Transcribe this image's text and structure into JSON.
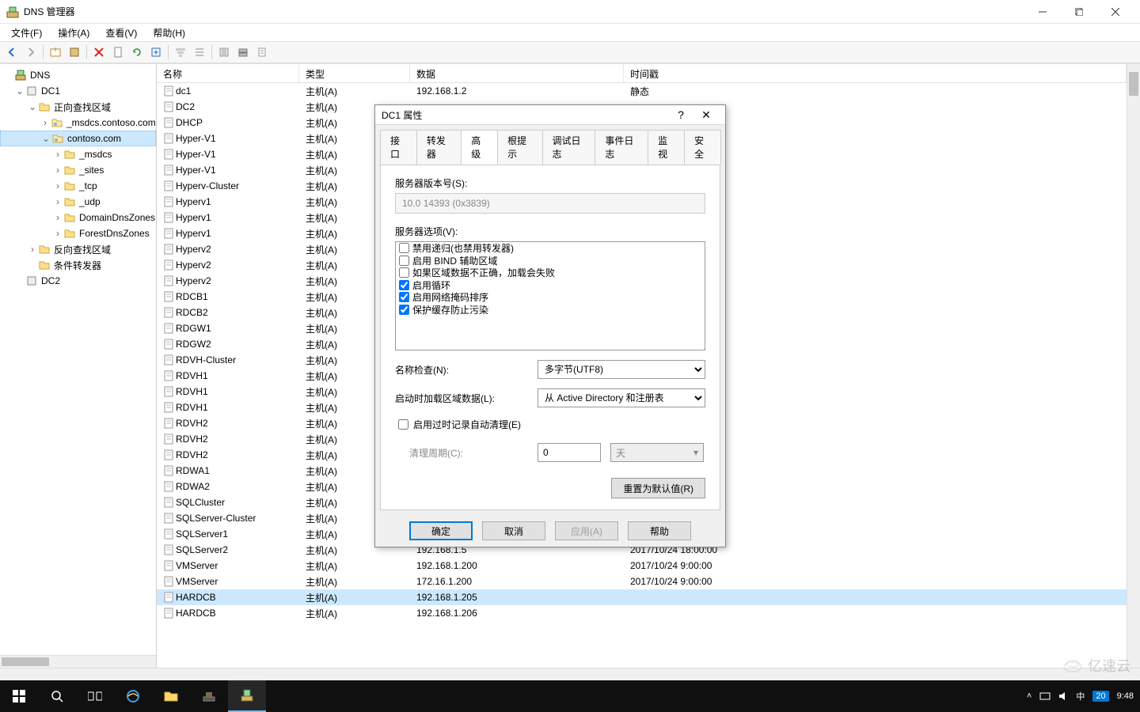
{
  "window": {
    "title": "DNS 管理器"
  },
  "menu": {
    "file": "文件(F)",
    "action": "操作(A)",
    "view": "查看(V)",
    "help": "帮助(H)"
  },
  "tree": {
    "root": "DNS",
    "dc1": "DC1",
    "fwd": "正向查找区域",
    "msdcs_contoso": "_msdcs.contoso.com",
    "contoso": "contoso.com",
    "msdcs": "_msdcs",
    "sites": "_sites",
    "tcp": "_tcp",
    "udp": "_udp",
    "domaindns": "DomainDnsZones",
    "forestdns": "ForestDnsZones",
    "rev": "反向查找区域",
    "cond": "条件转发器",
    "dc2": "DC2"
  },
  "columns": {
    "name": "名称",
    "type": "类型",
    "data": "数据",
    "ts": "时间戳"
  },
  "records": [
    {
      "name": "dc1",
      "type": "主机(A)",
      "data": "192.168.1.2",
      "ts": "静态"
    },
    {
      "name": "DC2",
      "type": "主机(A)",
      "data": "",
      "ts": ""
    },
    {
      "name": "DHCP",
      "type": "主机(A)",
      "data": "",
      "ts": ""
    },
    {
      "name": "Hyper-V1",
      "type": "主机(A)",
      "data": "",
      "ts": ""
    },
    {
      "name": "Hyper-V1",
      "type": "主机(A)",
      "data": "",
      "ts": ""
    },
    {
      "name": "Hyper-V1",
      "type": "主机(A)",
      "data": "",
      "ts": ""
    },
    {
      "name": "Hyperv-Cluster",
      "type": "主机(A)",
      "data": "",
      "ts": ""
    },
    {
      "name": "Hyperv1",
      "type": "主机(A)",
      "data": "",
      "ts": ""
    },
    {
      "name": "Hyperv1",
      "type": "主机(A)",
      "data": "",
      "ts": ""
    },
    {
      "name": "Hyperv1",
      "type": "主机(A)",
      "data": "",
      "ts": ""
    },
    {
      "name": "Hyperv2",
      "type": "主机(A)",
      "data": "",
      "ts": ""
    },
    {
      "name": "Hyperv2",
      "type": "主机(A)",
      "data": "",
      "ts": ""
    },
    {
      "name": "Hyperv2",
      "type": "主机(A)",
      "data": "",
      "ts": ""
    },
    {
      "name": "RDCB1",
      "type": "主机(A)",
      "data": "",
      "ts": ""
    },
    {
      "name": "RDCB2",
      "type": "主机(A)",
      "data": "",
      "ts": ""
    },
    {
      "name": "RDGW1",
      "type": "主机(A)",
      "data": "",
      "ts": ""
    },
    {
      "name": "RDGW2",
      "type": "主机(A)",
      "data": "",
      "ts": ""
    },
    {
      "name": "RDVH-Cluster",
      "type": "主机(A)",
      "data": "",
      "ts": ""
    },
    {
      "name": "RDVH1",
      "type": "主机(A)",
      "data": "",
      "ts": ""
    },
    {
      "name": "RDVH1",
      "type": "主机(A)",
      "data": "",
      "ts": ""
    },
    {
      "name": "RDVH1",
      "type": "主机(A)",
      "data": "",
      "ts": ""
    },
    {
      "name": "RDVH2",
      "type": "主机(A)",
      "data": "",
      "ts": ""
    },
    {
      "name": "RDVH2",
      "type": "主机(A)",
      "data": "",
      "ts": ""
    },
    {
      "name": "RDVH2",
      "type": "主机(A)",
      "data": "",
      "ts": ""
    },
    {
      "name": "RDWA1",
      "type": "主机(A)",
      "data": "",
      "ts": ""
    },
    {
      "name": "RDWA2",
      "type": "主机(A)",
      "data": "",
      "ts": ""
    },
    {
      "name": "SQLCluster",
      "type": "主机(A)",
      "data": "",
      "ts": ""
    },
    {
      "name": "SQLServer-Cluster",
      "type": "主机(A)",
      "data": "",
      "ts": ""
    },
    {
      "name": "SQLServer1",
      "type": "主机(A)",
      "data": "",
      "ts": ""
    },
    {
      "name": "SQLServer2",
      "type": "主机(A)",
      "data": "192.168.1.5",
      "ts": "2017/10/24 18:00:00"
    },
    {
      "name": "VMServer",
      "type": "主机(A)",
      "data": "192.168.1.200",
      "ts": "2017/10/24 9:00:00"
    },
    {
      "name": "VMServer",
      "type": "主机(A)",
      "data": "172.16.1.200",
      "ts": "2017/10/24 9:00:00"
    },
    {
      "name": "HARDCB",
      "type": "主机(A)",
      "data": "192.168.1.205",
      "ts": "",
      "sel": true
    },
    {
      "name": "HARDCB",
      "type": "主机(A)",
      "data": "192.168.1.206",
      "ts": ""
    }
  ],
  "dialog": {
    "title": "DC1 属性",
    "tabs": {
      "iface": "接口",
      "fwd": "转发器",
      "adv": "高级",
      "root": "根提示",
      "debug": "调试日志",
      "event": "事件日志",
      "mon": "监视",
      "sec": "安全"
    },
    "version_label": "服务器版本号(S):",
    "version_value": "10.0 14393 (0x3839)",
    "options_label": "服务器选项(V):",
    "options": [
      {
        "label": "禁用递归(也禁用转发器)",
        "checked": false
      },
      {
        "label": "启用 BIND 辅助区域",
        "checked": false
      },
      {
        "label": "如果区域数据不正确，加载会失败",
        "checked": false
      },
      {
        "label": "启用循环",
        "checked": true
      },
      {
        "label": "启用网络掩码排序",
        "checked": true
      },
      {
        "label": "保护缓存防止污染",
        "checked": true
      }
    ],
    "namecheck_label": "名称检查(N):",
    "namecheck_value": "多字节(UTF8)",
    "loadzone_label": "启动时加载区域数据(L):",
    "loadzone_value": "从 Active Directory 和注册表",
    "scavenge_label": "启用过时记录自动清理(E)",
    "period_label": "清理周期(C):",
    "period_value": "0",
    "period_unit": "天",
    "reset": "重置为默认值(R)",
    "ok": "确定",
    "cancel": "取消",
    "apply": "应用(A)",
    "help": "帮助"
  },
  "tray": {
    "time": "9:48",
    "ime": "中",
    "notif": "20"
  },
  "watermark": "亿速云"
}
